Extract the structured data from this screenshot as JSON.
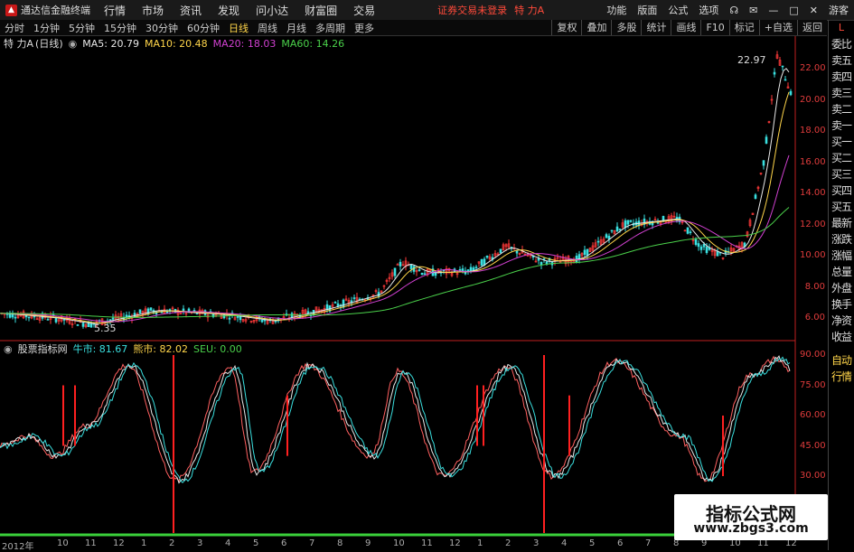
{
  "menubar": {
    "app_title": "通达信金融终端",
    "items": [
      "行情",
      "市场",
      "资讯",
      "发现",
      "问小达",
      "财富圈",
      "交易"
    ],
    "warning": "证券交易未登录",
    "stock": "特 力A",
    "right_items": [
      "功能",
      "版面",
      "公式",
      "选项"
    ],
    "guest": "游客"
  },
  "toolbar": {
    "periods": [
      "分时",
      "1分钟",
      "5分钟",
      "15分钟",
      "30分钟",
      "60分钟",
      "日线",
      "周线",
      "月线",
      "多周期",
      "更多"
    ],
    "active": "日线",
    "right_items": [
      "复权",
      "叠加",
      "多股",
      "统计",
      "画线",
      "F10",
      "标记",
      "+自选",
      "返回"
    ]
  },
  "main_info": {
    "name": "特 力A",
    "period": "(日线)",
    "ma5": "MA5: 20.79",
    "ma10": "MA10: 20.48",
    "ma20": "MA20: 18.03",
    "ma60": "MA60: 14.26"
  },
  "indicator_info": {
    "name": "股票指标网",
    "bull": "牛市: 81.67",
    "bear": "熊市: 82.02",
    "seu": "SEU: 0.00"
  },
  "annotations": {
    "high": "22.97",
    "low": "5.35"
  },
  "price_axis": [
    "22.00",
    "20.00",
    "18.00",
    "16.00",
    "14.00",
    "12.00",
    "10.00",
    "8.00",
    "6.00"
  ],
  "ind_axis": [
    "90.00",
    "75.00",
    "60.00",
    "45.00",
    "30.00"
  ],
  "side_top": "L",
  "side_items": [
    "委比",
    "卖五",
    "卖四",
    "卖三",
    "卖二",
    "卖一",
    "买一",
    "买二",
    "买三",
    "买四",
    "买五",
    "最新",
    "涨跌",
    "涨幅",
    "总量",
    "外盘",
    "换手",
    "净资",
    "收益",
    "自动",
    "行情"
  ],
  "dates": [
    "2012年",
    "10",
    "11",
    "12",
    "1",
    "2",
    "3",
    "4",
    "5",
    "6",
    "7",
    "8",
    "9",
    "10",
    "11",
    "12",
    "1",
    "2",
    "3",
    "4",
    "5",
    "6",
    "7",
    "8",
    "9",
    "10",
    "11",
    "12"
  ],
  "watermark": {
    "title": "指标公式网",
    "url": "www.zbgs3.com"
  },
  "colors": {
    "ma5": "#e8e8e8",
    "ma10": "#ffd54a",
    "ma20": "#d040d0",
    "ma60": "#4ad04a",
    "up": "#ff3a3a",
    "down": "#3ae0e0"
  }
}
